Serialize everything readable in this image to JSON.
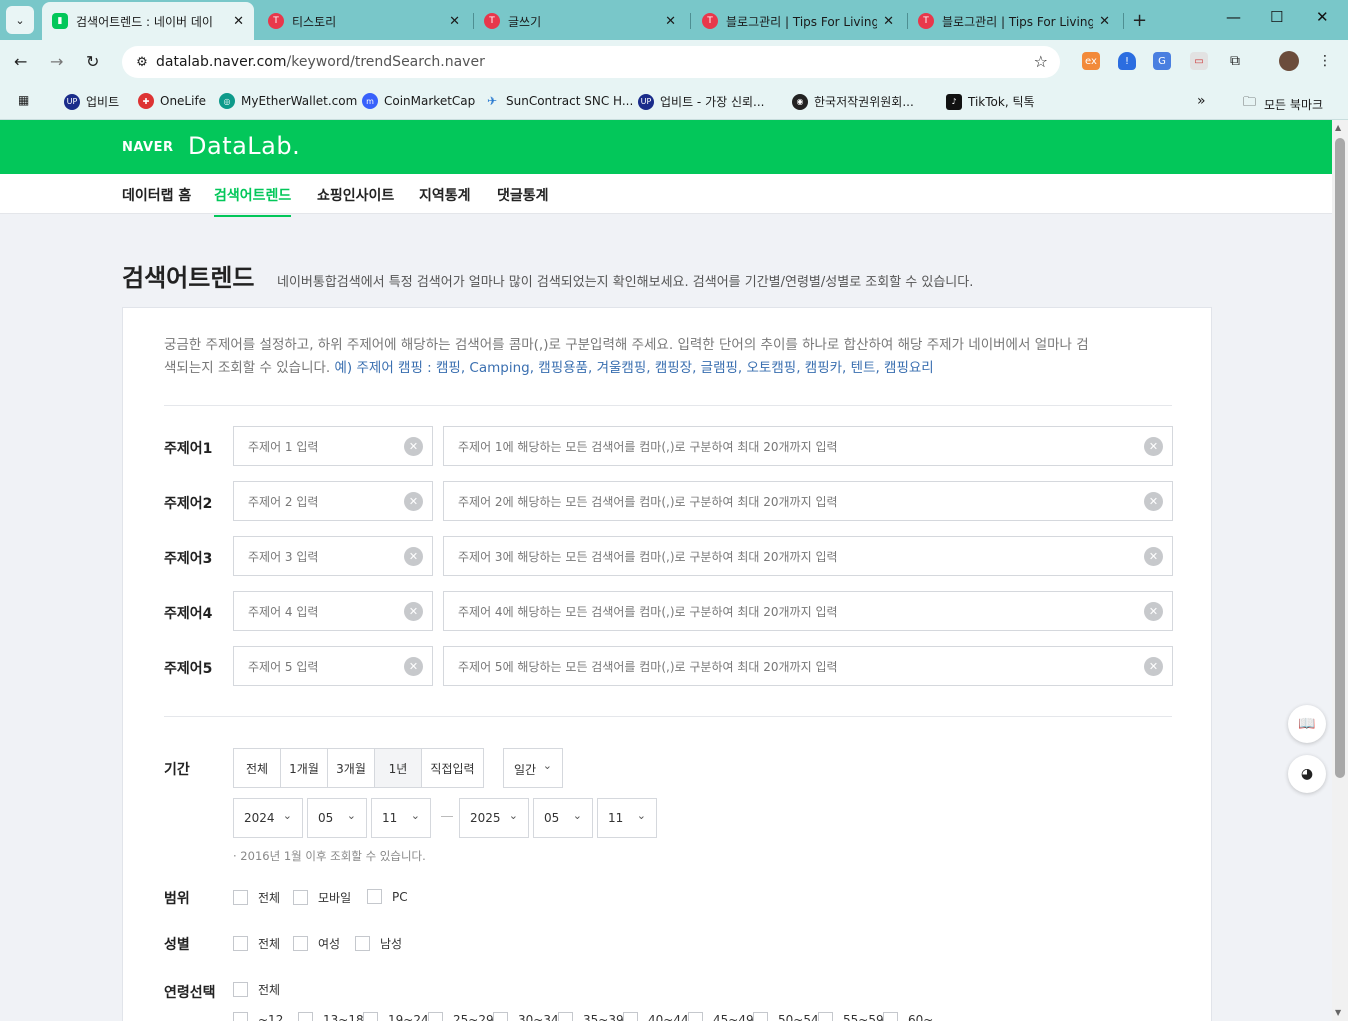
{
  "browser": {
    "tabs": [
      {
        "title": "검색어트렌드 : 네이버 데이",
        "active": true
      },
      {
        "title": "티스토리"
      },
      {
        "title": "글쓰기"
      },
      {
        "title": "블로그관리 | Tips For Living"
      },
      {
        "title": "블로그관리 | Tips For Living"
      }
    ],
    "url_host": "datalab.naver.com",
    "url_path": "/keyword/trendSearch.naver",
    "bookmarks": [
      "업비트",
      "OneLife",
      "MyEtherWallet.com",
      "CoinMarketCap",
      "SunContract SNC H...",
      "업비트 - 가장 신뢰...",
      "한국저작권위원회...",
      "TikTok, 틱톡"
    ],
    "all_bookmarks": "모든 북마크"
  },
  "header": {
    "brand": "NAVER",
    "product": "DataLab."
  },
  "nav": [
    "데이터랩 홈",
    "검색어트렌드",
    "쇼핑인사이트",
    "지역통계",
    "댓글통계"
  ],
  "page": {
    "title": "검색어트렌드",
    "description": "네이버통합검색에서 특정 검색어가 얼마나 많이 검색되었는지 확인해보세요. 검색어를 기간별/연령별/성별로 조회할 수 있습니다.",
    "intro_line1": "궁금한 주제어를 설정하고, 하위 주제어에 해당하는 검색어를 콤마(,)로 구분입력해 주세요. 입력한 단어의 추이를 하나로 합산하여 해당 주제가 네이버에서 얼마나 검",
    "intro_line2_a": "색되는지 조회할 수 있습니다. ",
    "intro_line2_b": "예) 주제어 캠핑 : 캠핑, Camping, 캠핑용품, 겨울캠핑, 캠핑장, 글램핑, 오토캠핑, 캠핑카, 텐트, 캠핑요리"
  },
  "topics": [
    {
      "label": "주제어1",
      "topic_placeholder": "주제어 1 입력",
      "keywords_placeholder": "주제어 1에 해당하는 모든 검색어를 컴마(,)로 구분하여 최대 20개까지 입력"
    },
    {
      "label": "주제어2",
      "topic_placeholder": "주제어 2 입력",
      "keywords_placeholder": "주제어 2에 해당하는 모든 검색어를 컴마(,)로 구분하여 최대 20개까지 입력"
    },
    {
      "label": "주제어3",
      "topic_placeholder": "주제어 3 입력",
      "keywords_placeholder": "주제어 3에 해당하는 모든 검색어를 컴마(,)로 구분하여 최대 20개까지 입력"
    },
    {
      "label": "주제어4",
      "topic_placeholder": "주제어 4 입력",
      "keywords_placeholder": "주제어 4에 해당하는 모든 검색어를 컴마(,)로 구분하여 최대 20개까지 입력"
    },
    {
      "label": "주제어5",
      "topic_placeholder": "주제어 5 입력",
      "keywords_placeholder": "주제어 5에 해당하는 모든 검색어를 컴마(,)로 구분하여 최대 20개까지 입력"
    }
  ],
  "period": {
    "label": "기간",
    "options": [
      "전체",
      "1개월",
      "3개월",
      "1년",
      "직접입력"
    ],
    "selected": "1년",
    "interval": "일간",
    "start": {
      "year": "2024",
      "month": "05",
      "day": "11"
    },
    "end": {
      "year": "2025",
      "month": "05",
      "day": "11"
    },
    "note": "· 2016년 1월 이후 조회할 수 있습니다."
  },
  "scope": {
    "label": "범위",
    "options": [
      "전체",
      "모바일",
      "PC"
    ]
  },
  "gender": {
    "label": "성별",
    "options": [
      "전체",
      "여성",
      "남성"
    ]
  },
  "age": {
    "label": "연령선택",
    "all": "전체",
    "ranges": [
      "~12",
      "13~18",
      "19~24",
      "25~29",
      "30~34",
      "35~39",
      "40~44",
      "45~49",
      "50~54",
      "55~59",
      "60~"
    ]
  }
}
